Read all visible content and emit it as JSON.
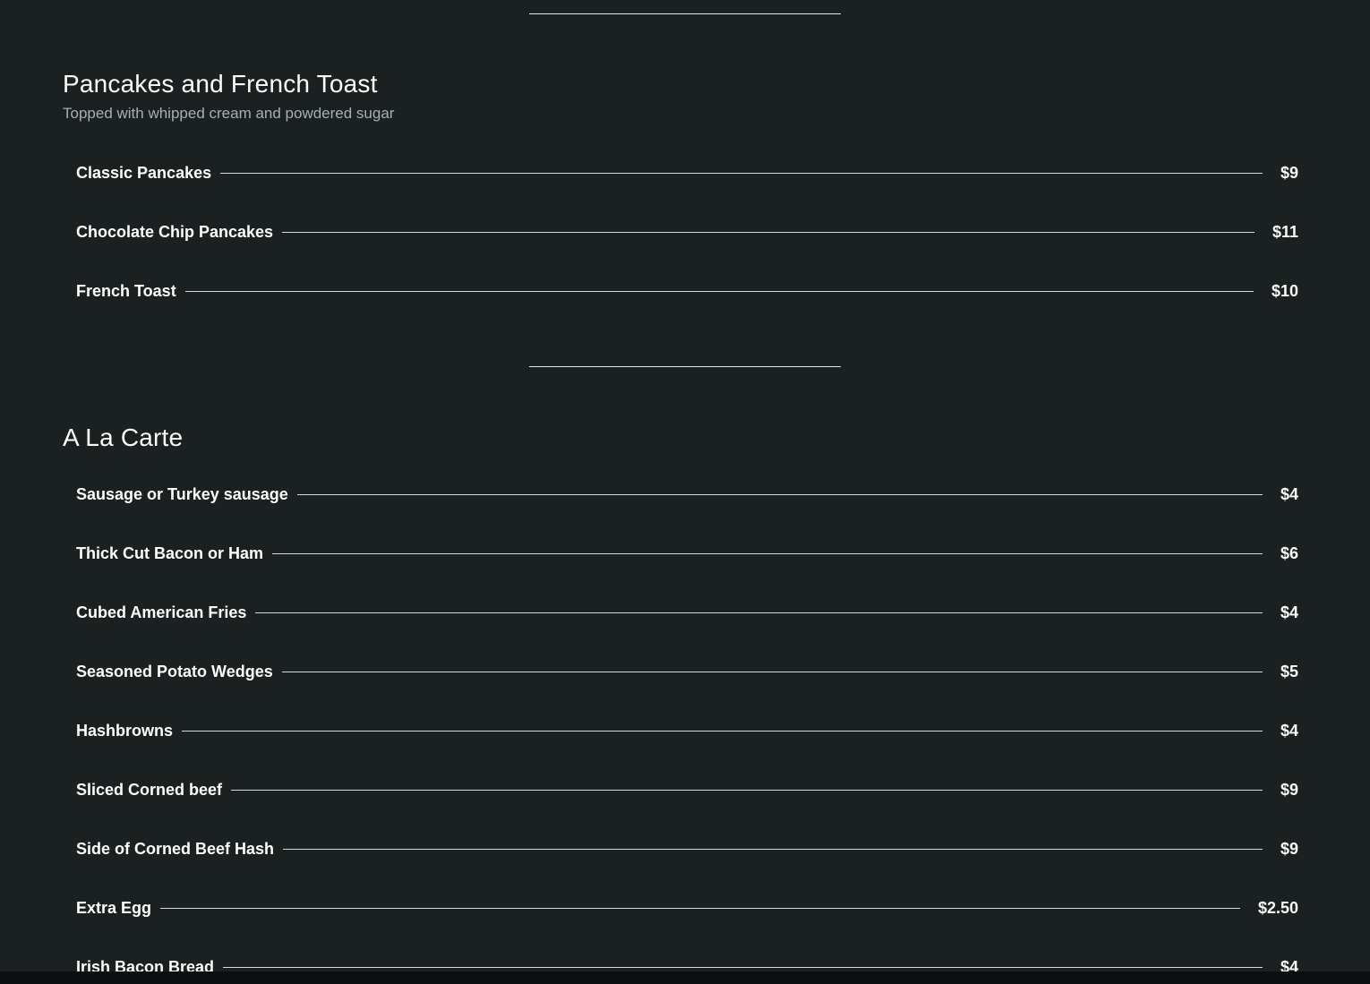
{
  "sections": [
    {
      "title": "Pancakes and French Toast",
      "subtitle": "Topped with whipped cream and powdered sugar",
      "items": [
        {
          "name": "Classic Pancakes",
          "price": "$9"
        },
        {
          "name": "Chocolate Chip Pancakes",
          "price": "$11"
        },
        {
          "name": "French Toast",
          "price": "$10"
        }
      ]
    },
    {
      "title": "A La Carte",
      "items": [
        {
          "name": "Sausage or Turkey sausage",
          "price": "$4"
        },
        {
          "name": "Thick Cut Bacon or Ham",
          "price": "$6"
        },
        {
          "name": "Cubed American Fries",
          "price": "$4"
        },
        {
          "name": "Seasoned Potato Wedges",
          "price": "$5"
        },
        {
          "name": "Hashbrowns",
          "price": "$4"
        },
        {
          "name": "Sliced Corned beef",
          "price": "$9"
        },
        {
          "name": "Side of Corned Beef Hash",
          "price": "$9"
        },
        {
          "name": "Extra Egg",
          "price": "$2.50"
        },
        {
          "name": "Irish Bacon Bread",
          "price": "$4"
        }
      ]
    }
  ],
  "colors": {
    "background": "#1b2021",
    "text": "#ffffff",
    "subtitle": "#a9aeaf",
    "rule": "#e6e6e6"
  }
}
